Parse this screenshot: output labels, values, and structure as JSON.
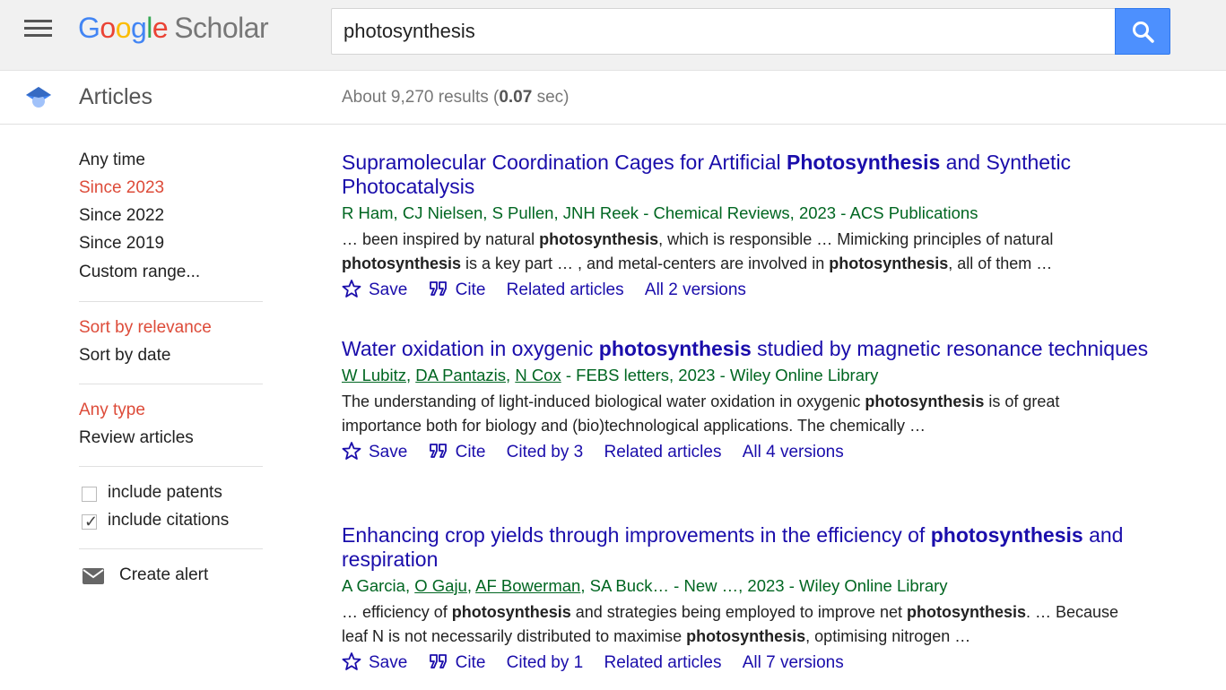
{
  "header": {
    "logo_letters": [
      "G",
      "o",
      "o",
      "g",
      "l",
      "e"
    ],
    "logo_scholar": "Scholar",
    "search_value": "photosynthesis"
  },
  "subheader": {
    "section": "Articles",
    "stats_prefix": "About 9,270 results (",
    "stats_time": "0.07",
    "stats_suffix": " sec)"
  },
  "sidebar": {
    "time_filters": [
      "Any time",
      "Since 2023",
      "Since 2022",
      "Since 2019",
      "Custom range..."
    ],
    "active_time": "Since 2023",
    "sort_options": [
      "Sort by relevance",
      "Sort by date"
    ],
    "type_options": [
      "Any type",
      "Review articles"
    ],
    "include_patents": "include patents",
    "include_citations": "include citations",
    "create_alert": "Create alert"
  },
  "results": [
    {
      "title_parts": [
        "Supramolecular Coordination Cages for Artificial ",
        "Photosynthesis",
        " and Synthetic Photocatalysis"
      ],
      "authors_plain": "R Ham, CJ Nielsen, S Pullen, JNH Reek",
      "source": " - Chemical Reviews, 2023 - ACS Publications",
      "snippet_parts": [
        "… been inspired by natural ",
        "photosynthesis",
        ", which is responsible … Mimicking principles of natural ",
        "photosynthesis",
        " is a key part … , and metal-centers are involved in ",
        "photosynthesis",
        ", all of them …"
      ],
      "actions": [
        "Save",
        "Cite",
        "Related articles",
        "All 2 versions"
      ]
    },
    {
      "title_parts": [
        "Water oxidation in oxygenic ",
        "photosynthesis",
        " studied by magnetic resonance techniques"
      ],
      "authors_linked": [
        "W Lubitz",
        "DA Pantazis",
        "N Cox"
      ],
      "source": " - FEBS letters, 2023 - Wiley Online Library",
      "snippet_parts": [
        "The understanding of light-induced biological water oxidation in oxygenic ",
        "photosynthesis",
        " is of great importance both for biology and (bio)technological applications. The chemically …"
      ],
      "actions": [
        "Save",
        "Cite",
        "Cited by 3",
        "Related articles",
        "All 4 versions"
      ]
    },
    {
      "title_parts": [
        "Enhancing crop yields through improvements in the efficiency of ",
        "photosynthesis",
        " and respiration"
      ],
      "authors_mixed": [
        "A Garcia",
        "O Gaju",
        "AF Bowerman",
        "SA Buck…"
      ],
      "source": " - New …, 2023 - Wiley Online Library",
      "snippet_parts": [
        "… efficiency of ",
        "photosynthesis",
        " and strategies being employed to improve net ",
        "photosynthesis",
        ". … Because leaf N is not necessarily distributed to maximise ",
        "photosynthesis",
        ", optimising nitrogen …"
      ],
      "actions": [
        "Save",
        "Cite",
        "Cited by 1",
        "Related articles",
        "All 7 versions"
      ]
    }
  ],
  "colors": {
    "link": "#1a0dab",
    "meta_green": "#006621",
    "active_red": "#dd4b39",
    "search_blue": "#4d90fe"
  }
}
